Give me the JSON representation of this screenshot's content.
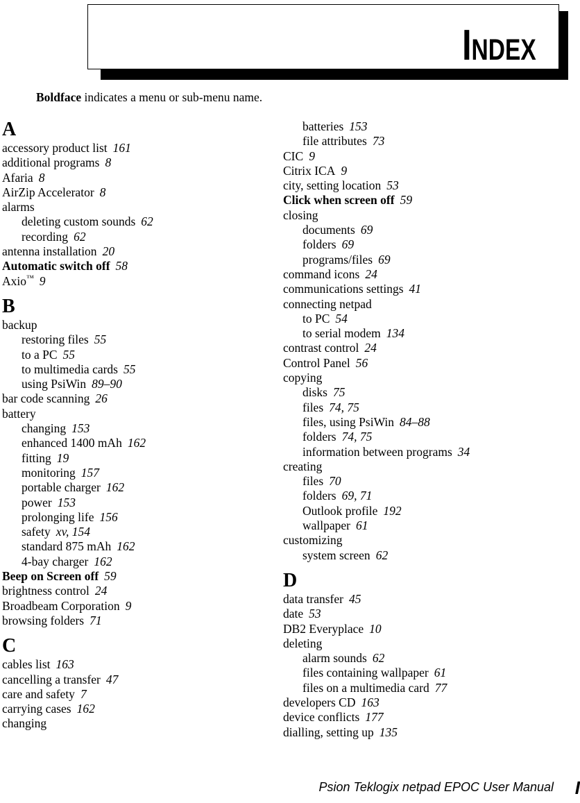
{
  "header": {
    "title": "Index"
  },
  "note": {
    "bold_word": "Boldface",
    "rest": " indicates a menu or sub-menu name."
  },
  "columns": [
    {
      "name": "left",
      "sections": [
        {
          "letter": "A",
          "entries": [
            {
              "level": 1,
              "bold": false,
              "term": "accessory product list",
              "pages": "161"
            },
            {
              "level": 1,
              "bold": false,
              "term": "additional programs",
              "pages": "8"
            },
            {
              "level": 1,
              "bold": false,
              "term": "Afaria",
              "pages": "8"
            },
            {
              "level": 1,
              "bold": false,
              "term": "AirZip Accelerator",
              "pages": "8"
            },
            {
              "level": 1,
              "bold": false,
              "term": "alarms",
              "pages": ""
            },
            {
              "level": 2,
              "bold": false,
              "term": "deleting custom sounds",
              "pages": "62"
            },
            {
              "level": 2,
              "bold": false,
              "term": "recording",
              "pages": "62"
            },
            {
              "level": 1,
              "bold": false,
              "term": "antenna installation",
              "pages": "20"
            },
            {
              "level": 1,
              "bold": true,
              "term": "Automatic switch off",
              "pages": "58"
            },
            {
              "level": 1,
              "bold": false,
              "term": "Axio",
              "trademark": true,
              "pages": "9"
            }
          ]
        },
        {
          "letter": "B",
          "entries": [
            {
              "level": 1,
              "bold": false,
              "term": "backup",
              "pages": ""
            },
            {
              "level": 2,
              "bold": false,
              "term": "restoring files",
              "pages": "55"
            },
            {
              "level": 2,
              "bold": false,
              "term": "to a PC",
              "pages": "55"
            },
            {
              "level": 2,
              "bold": false,
              "term": "to multimedia cards",
              "pages": "55"
            },
            {
              "level": 2,
              "bold": false,
              "term": "using PsiWin",
              "pages": "89–90"
            },
            {
              "level": 1,
              "bold": false,
              "term": "bar code scanning",
              "pages": "26"
            },
            {
              "level": 1,
              "bold": false,
              "term": "battery",
              "pages": ""
            },
            {
              "level": 2,
              "bold": false,
              "term": "changing",
              "pages": "153"
            },
            {
              "level": 2,
              "bold": false,
              "term": "enhanced 1400 mAh",
              "pages": "162"
            },
            {
              "level": 2,
              "bold": false,
              "term": "fitting",
              "pages": "19"
            },
            {
              "level": 2,
              "bold": false,
              "term": "monitoring",
              "pages": "157"
            },
            {
              "level": 2,
              "bold": false,
              "term": "portable charger",
              "pages": "162"
            },
            {
              "level": 2,
              "bold": false,
              "term": "power",
              "pages": "153"
            },
            {
              "level": 2,
              "bold": false,
              "term": "prolonging life",
              "pages": "156"
            },
            {
              "level": 2,
              "bold": false,
              "term": "safety",
              "pages": "xv, 154"
            },
            {
              "level": 2,
              "bold": false,
              "term": "standard 875 mAh",
              "pages": "162"
            },
            {
              "level": 2,
              "bold": false,
              "term": "4-bay charger",
              "pages": "162"
            },
            {
              "level": 1,
              "bold": true,
              "term": "Beep on Screen off",
              "pages": "59"
            },
            {
              "level": 1,
              "bold": false,
              "term": "brightness control",
              "pages": "24"
            },
            {
              "level": 1,
              "bold": false,
              "term": "Broadbeam Corporation",
              "pages": "9"
            },
            {
              "level": 1,
              "bold": false,
              "term": "browsing folders",
              "pages": "71"
            }
          ]
        },
        {
          "letter": "C",
          "entries": [
            {
              "level": 1,
              "bold": false,
              "term": "cables list",
              "pages": "163"
            },
            {
              "level": 1,
              "bold": false,
              "term": "cancelling a transfer",
              "pages": "47"
            },
            {
              "level": 1,
              "bold": false,
              "term": "care and safety",
              "pages": "7"
            },
            {
              "level": 1,
              "bold": false,
              "term": "carrying cases",
              "pages": "162"
            },
            {
              "level": 1,
              "bold": false,
              "term": "changing",
              "pages": ""
            }
          ]
        }
      ]
    },
    {
      "name": "right",
      "sections": [
        {
          "letter": "",
          "entries": [
            {
              "level": 2,
              "bold": false,
              "term": "batteries",
              "pages": "153"
            },
            {
              "level": 2,
              "bold": false,
              "term": "file attributes",
              "pages": "73"
            },
            {
              "level": 1,
              "bold": false,
              "term": "CIC",
              "pages": "9"
            },
            {
              "level": 1,
              "bold": false,
              "term": "Citrix ICA",
              "pages": "9"
            },
            {
              "level": 1,
              "bold": false,
              "term": "city, setting location",
              "pages": "53"
            },
            {
              "level": 1,
              "bold": true,
              "term": "Click when screen off",
              "pages": "59"
            },
            {
              "level": 1,
              "bold": false,
              "term": "closing",
              "pages": ""
            },
            {
              "level": 2,
              "bold": false,
              "term": "documents",
              "pages": "69"
            },
            {
              "level": 2,
              "bold": false,
              "term": "folders",
              "pages": "69"
            },
            {
              "level": 2,
              "bold": false,
              "term": "programs/files",
              "pages": "69"
            },
            {
              "level": 1,
              "bold": false,
              "term": "command icons",
              "pages": "24"
            },
            {
              "level": 1,
              "bold": false,
              "term": "communications settings",
              "pages": "41"
            },
            {
              "level": 1,
              "bold": false,
              "term": "connecting netpad",
              "pages": ""
            },
            {
              "level": 2,
              "bold": false,
              "term": "to PC",
              "pages": "54"
            },
            {
              "level": 2,
              "bold": false,
              "term": "to serial modem",
              "pages": "134"
            },
            {
              "level": 1,
              "bold": false,
              "term": "contrast control",
              "pages": "24"
            },
            {
              "level": 1,
              "bold": false,
              "term": "Control Panel",
              "pages": "56"
            },
            {
              "level": 1,
              "bold": false,
              "term": "copying",
              "pages": ""
            },
            {
              "level": 2,
              "bold": false,
              "term": "disks",
              "pages": "75"
            },
            {
              "level": 2,
              "bold": false,
              "term": "files",
              "pages": "74, 75"
            },
            {
              "level": 2,
              "bold": false,
              "term": "files, using PsiWin",
              "pages": "84–88"
            },
            {
              "level": 2,
              "bold": false,
              "term": "folders",
              "pages": "74, 75"
            },
            {
              "level": 2,
              "bold": false,
              "term": "information between programs",
              "pages": "34"
            },
            {
              "level": 1,
              "bold": false,
              "term": "creating",
              "pages": ""
            },
            {
              "level": 2,
              "bold": false,
              "term": "files",
              "pages": "70"
            },
            {
              "level": 2,
              "bold": false,
              "term": "folders",
              "pages": "69, 71"
            },
            {
              "level": 2,
              "bold": false,
              "term": "Outlook profile",
              "pages": "192"
            },
            {
              "level": 2,
              "bold": false,
              "term": "wallpaper",
              "pages": "61"
            },
            {
              "level": 1,
              "bold": false,
              "term": "customizing",
              "pages": ""
            },
            {
              "level": 2,
              "bold": false,
              "term": "system screen",
              "pages": "62"
            }
          ]
        },
        {
          "letter": "D",
          "entries": [
            {
              "level": 1,
              "bold": false,
              "term": "data transfer",
              "pages": "45"
            },
            {
              "level": 1,
              "bold": false,
              "term": "date",
              "pages": "53"
            },
            {
              "level": 1,
              "bold": false,
              "term": "DB2 Everyplace",
              "pages": "10"
            },
            {
              "level": 1,
              "bold": false,
              "term": "deleting",
              "pages": ""
            },
            {
              "level": 2,
              "bold": false,
              "term": "alarm sounds",
              "pages": "62"
            },
            {
              "level": 2,
              "bold": false,
              "term": "files containing wallpaper",
              "pages": "61"
            },
            {
              "level": 2,
              "bold": false,
              "term": "files on a multimedia card",
              "pages": "77"
            },
            {
              "level": 1,
              "bold": false,
              "term": "developers CD",
              "pages": "163"
            },
            {
              "level": 1,
              "bold": false,
              "term": "device conflicts",
              "pages": "177"
            },
            {
              "level": 1,
              "bold": false,
              "term": "dialling, setting up",
              "pages": "135"
            }
          ]
        }
      ]
    }
  ],
  "footer": {
    "manual_title": "Psion Teklogix netpad EPOC User Manual",
    "page_number": "I"
  },
  "colors": {
    "ink": "#000000",
    "paper": "#ffffff"
  }
}
